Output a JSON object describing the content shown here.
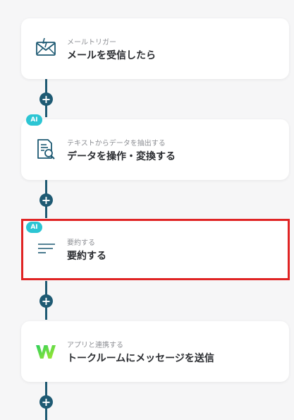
{
  "flow": {
    "steps": [
      {
        "subtitle": "メールトリガー",
        "title": "メールを受信したら",
        "ai_badge": "",
        "icon": "mail-icon"
      },
      {
        "subtitle": "テキストからデータを抽出する",
        "title": "データを操作・変換する",
        "ai_badge": "AI",
        "icon": "document-search-icon"
      },
      {
        "subtitle": "要約する",
        "title": "要約する",
        "ai_badge": "AI",
        "icon": "summary-lines-icon"
      },
      {
        "subtitle": "アプリと連携する",
        "title": "トークルームにメッセージを送信",
        "ai_badge": "",
        "icon": "chatwork-w-logo-icon"
      }
    ],
    "add_label": "+"
  },
  "colors": {
    "connector": "#1e5a73",
    "ai_badge": "#2cc5d3",
    "selected_border": "#e02424",
    "icon_stroke": "#1e5a73"
  }
}
